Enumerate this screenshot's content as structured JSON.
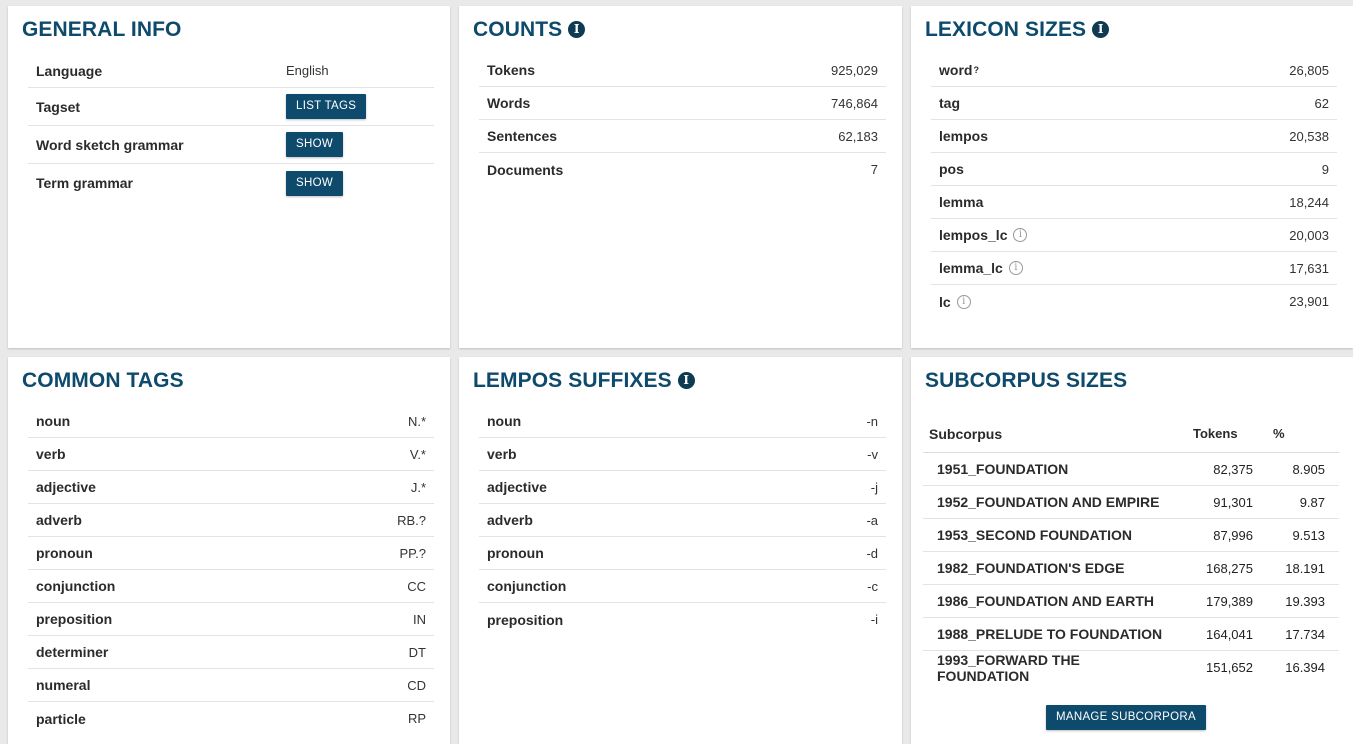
{
  "general": {
    "title": "GENERAL INFO",
    "language_label": "Language",
    "language_value": "English",
    "tagset_label": "Tagset",
    "tagset_button": "LIST TAGS",
    "wsg_label": "Word sketch grammar",
    "wsg_button": "SHOW",
    "term_label": "Term grammar",
    "term_button": "SHOW"
  },
  "counts": {
    "title": "COUNTS",
    "rows": [
      {
        "label": "Tokens",
        "value": "925,029"
      },
      {
        "label": "Words",
        "value": "746,864"
      },
      {
        "label": "Sentences",
        "value": "62,183"
      },
      {
        "label": "Documents",
        "value": "7"
      }
    ]
  },
  "lexicon": {
    "title": "LEXICON SIZES",
    "word_sup": "?",
    "rows": [
      {
        "label": "word",
        "value": "26,805"
      },
      {
        "label": "tag",
        "value": "62"
      },
      {
        "label": "lempos",
        "value": "20,538"
      },
      {
        "label": "pos",
        "value": "9"
      },
      {
        "label": "lemma",
        "value": "18,244"
      },
      {
        "label": "lempos_lc",
        "value": "20,003"
      },
      {
        "label": "lemma_lc",
        "value": "17,631"
      },
      {
        "label": "lc",
        "value": "23,901"
      }
    ]
  },
  "common_tags": {
    "title": "COMMON TAGS",
    "rows": [
      {
        "label": "noun",
        "value": "N.*"
      },
      {
        "label": "verb",
        "value": "V.*"
      },
      {
        "label": "adjective",
        "value": "J.*"
      },
      {
        "label": "adverb",
        "value": "RB.?"
      },
      {
        "label": "pronoun",
        "value": "PP.?"
      },
      {
        "label": "conjunction",
        "value": "CC"
      },
      {
        "label": "preposition",
        "value": "IN"
      },
      {
        "label": "determiner",
        "value": "DT"
      },
      {
        "label": "numeral",
        "value": "CD"
      },
      {
        "label": "particle",
        "value": "RP"
      }
    ]
  },
  "lempos": {
    "title": "LEMPOS SUFFIXES",
    "rows": [
      {
        "label": "noun",
        "value": "-n"
      },
      {
        "label": "verb",
        "value": "-v"
      },
      {
        "label": "adjective",
        "value": "-j"
      },
      {
        "label": "adverb",
        "value": "-a"
      },
      {
        "label": "pronoun",
        "value": "-d"
      },
      {
        "label": "conjunction",
        "value": "-c"
      },
      {
        "label": "preposition",
        "value": "-i"
      }
    ]
  },
  "subcorpus": {
    "title": "SUBCORPUS SIZES",
    "headers": [
      "Subcorpus",
      "Tokens",
      "%"
    ],
    "rows": [
      [
        "1951_FOUNDATION",
        "82,375",
        "8.905"
      ],
      [
        "1952_FOUNDATION AND EMPIRE",
        "91,301",
        "9.87"
      ],
      [
        "1953_SECOND FOUNDATION",
        "87,996",
        "9.513"
      ],
      [
        "1982_FOUNDATION'S EDGE",
        "168,275",
        "18.191"
      ],
      [
        "1986_FOUNDATION AND EARTH",
        "179,389",
        "19.393"
      ],
      [
        "1988_PRELUDE TO FOUNDATION",
        "164,041",
        "17.734"
      ],
      [
        "1993_FORWARD THE FOUNDATION",
        "151,652",
        "16.394"
      ]
    ],
    "manage_button": "MANAGE SUBCORPORA"
  },
  "icons": {
    "info": "info-icon",
    "help": "help-circle-icon"
  },
  "colors": {
    "accent": "#0e4a6c",
    "background": "#e9e9e9"
  }
}
